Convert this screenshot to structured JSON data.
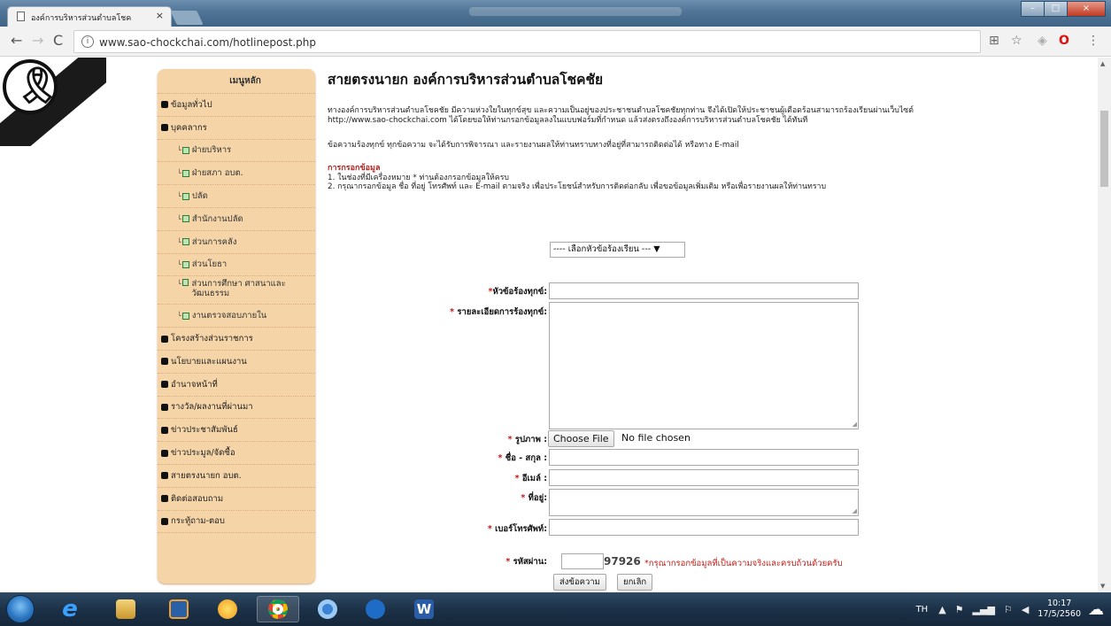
{
  "browser": {
    "tab_title": "องค์การบริหารส่วนตำบลโชค",
    "tab_close": "×",
    "url": "www.sao-chockchai.com/hotlinepost.php",
    "window_buttons": [
      "–",
      "□",
      "×"
    ]
  },
  "sidebar": {
    "heading": "เมนูหลัก",
    "items": [
      {
        "label": "ข้อมูลทั่วไป",
        "sub": false
      },
      {
        "label": "บุคคลากร",
        "sub": false
      },
      {
        "label": "ฝ่ายบริหาร",
        "sub": true
      },
      {
        "label": "ฝ่ายสภา อบต.",
        "sub": true
      },
      {
        "label": "ปลัด",
        "sub": true
      },
      {
        "label": "สำนักงานปลัด",
        "sub": true
      },
      {
        "label": "ส่วนการคลัง",
        "sub": true
      },
      {
        "label": "ส่วนโยธา",
        "sub": true
      },
      {
        "label": "ส่วนการศึกษา ศาสนาและวัฒนธรรม",
        "sub": true
      },
      {
        "label": "งานตรวจสอบภายใน",
        "sub": true
      },
      {
        "label": "โครงสร้างส่วนราชการ",
        "sub": false
      },
      {
        "label": "นโยบายและแผนงาน",
        "sub": false
      },
      {
        "label": "อำนาจหน้าที่",
        "sub": false
      },
      {
        "label": "รางวัล/ผลงานที่ผ่านมา",
        "sub": false
      },
      {
        "label": "ข่าวประชาสัมพันธ์",
        "sub": false
      },
      {
        "label": "ข่าวประมูล/จัดซื้อ",
        "sub": false
      },
      {
        "label": "สายตรงนายก อบต.",
        "sub": false
      },
      {
        "label": "ติดต่อสอบถาม",
        "sub": false
      },
      {
        "label": "กระทู้ถาม-ตอบ",
        "sub": false
      }
    ]
  },
  "main": {
    "title": "สายตรงนายก องค์การบริหารส่วนตำบลโชคชัย",
    "intro": "ทางองค์การบริหารส่วนตำบลโชคชัย มีความห่วงใยในทุกข์สุข และความเป็นอยู่ของประชาชนตำบลโชคชัยทุกท่าน จึงได้เปิดให้ประชาชนผู้เดือดร้อนสามารถร้องเรียนผ่านเว็บไซต์ http://www.sao-chockchai.com ได้โดยขอให้ท่านกรอกข้อมูลลงในแบบฟอร์มที่กำหนด แล้วส่งตรงถึงองค์การบริหารส่วนตำบลโชคชัย ได้ทันที",
    "notice": "ข้อความร้องทุกข์ ทุกข้อความ จะได้รับการพิจารณา และรายงานผลให้ท่านทราบทางที่อยู่ที่สามารถติดต่อได้ หรือทาง E-mail",
    "howto_title": "การกรอกข้อมูล",
    "howto_1": "1. ในช่องที่มีเครื่องหมาย * ท่านต้องกรอกข้อมูลให้ครบ",
    "howto_2": "2. กรุณากรอกข้อมูล ชื่อ ที่อยู่ โทรศัพท์ และ E-mail ตามจริง เพื่อประโยชน์สำหรับการติดต่อกลับ เพื่อขอข้อมูลเพิ่มเติม หรือเพื่อรายงานผลให้ท่านทราบ"
  },
  "form": {
    "topic_select": "---- เลือกหัวข้อร้องเรียน ---",
    "star": "*",
    "subject_label": "หัวข้อร้องทุกข์:",
    "detail_label": " รายละเอียดการร้องทุกข์:",
    "image_label": " รูปภาพ :",
    "choose_file": "Choose File",
    "no_file": "No file chosen",
    "name_label": " ชื่อ - สกุล :",
    "email_label": " อีเมล์ :",
    "address_label": " ที่อยู่:",
    "phone_label": " เบอร์โทรศัพท์:",
    "password_label": " รหัสผ่าน:",
    "captcha_code": "97926",
    "captcha_note": "*กรุณากรอกข้อมูลที่เป็นความจริงและครบถ้วนด้วยครับ",
    "submit_label": "ส่งข้อความ",
    "cancel_label": "ยกเลิก"
  },
  "taskbar": {
    "lang": "TH",
    "time": "10:17",
    "date": "17/5/2560",
    "apps": [
      "internet-explorer-icon",
      "file-explorer-icon",
      "media-player-icon",
      "paint-icon",
      "chrome-icon",
      "chrome-alt-icon",
      "media-center-icon",
      "word-icon"
    ]
  },
  "colors": {
    "sidebar_bg": "#f5d5a8",
    "required_star": "#c21b17",
    "howto_title": "#b3251f"
  }
}
